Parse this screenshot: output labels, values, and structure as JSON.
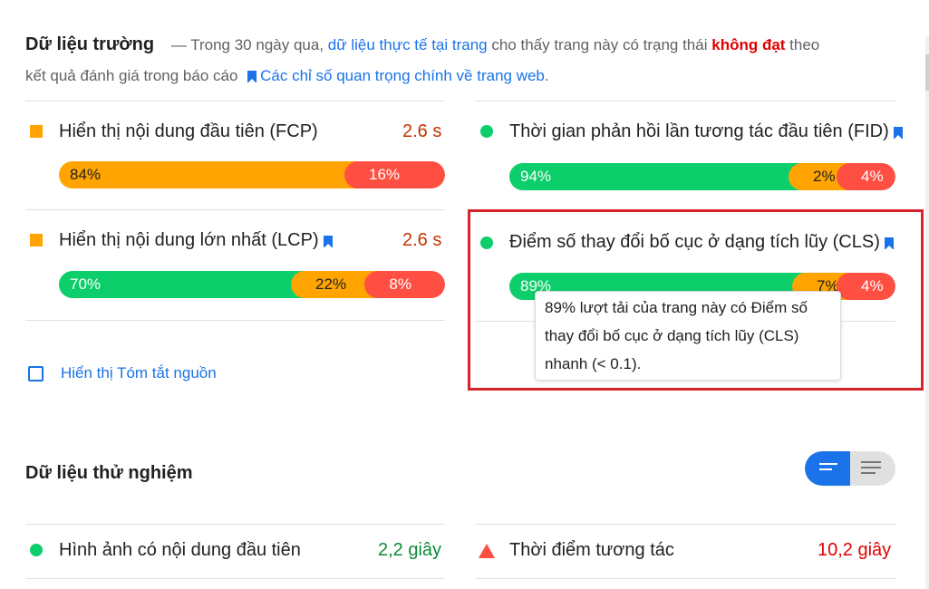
{
  "intro": {
    "heading": "Dữ liệu trường",
    "dash": "—",
    "text_1": " Trong 30 ngày qua, ",
    "link_1": "dữ liệu thực tế tại trang",
    "text_2": " cho thấy trang này có trạng thái ",
    "fail": "không đạt",
    "text_3": " theo kết quả đánh giá trong báo cáo ",
    "link_2": "Các chỉ số quan trọng chính về trang web",
    "period": "."
  },
  "metrics": {
    "fcp": {
      "title": "Hiển thị nội dung đầu tiên (FCP)",
      "value": "2.6 s",
      "fast": "84%",
      "avg": "",
      "slow": "16%",
      "dist": [
        84,
        0,
        16
      ]
    },
    "lcp": {
      "title": "Hiển thị nội dung lớn nhất (LCP)",
      "value": "2.6 s",
      "fast": "70%",
      "avg": "22%",
      "slow": "8%",
      "dist": [
        70,
        22,
        8
      ]
    },
    "fid": {
      "title": "Thời gian phản hồi lần tương tác đầu tiên (FID)",
      "fast": "94%",
      "avg": "2%",
      "slow": "4%",
      "dist": [
        94,
        2,
        4
      ]
    },
    "cls": {
      "title": "Điểm số thay đổi bố cục ở dạng tích lũy (CLS)",
      "fast": "89%",
      "avg": "7%",
      "slow": "4%",
      "dist": [
        89,
        7,
        4
      ]
    }
  },
  "tooltip": {
    "line1": "89% lượt tải của trang này có Điểm số",
    "line2": "thay đổi bố cục ở dạng tích lũy (CLS)",
    "line3": "nhanh (< 0.1)."
  },
  "source_summary": {
    "label": "Hiển thị Tóm tắt nguồn",
    "checked": false
  },
  "lab": {
    "heading": "Dữ liệu thử nghiệm",
    "items": [
      {
        "title": "Hình ảnh có nội dung đầu tiên",
        "value": "2,2 giây"
      },
      {
        "title": "Thời điểm tương tác",
        "value": "10,2 giây"
      }
    ]
  },
  "colors": {
    "fast": "#0cce6b",
    "average": "#ffa400",
    "slow": "#ff4e42",
    "link": "#1a73e8",
    "highlight": "#d9232a"
  }
}
